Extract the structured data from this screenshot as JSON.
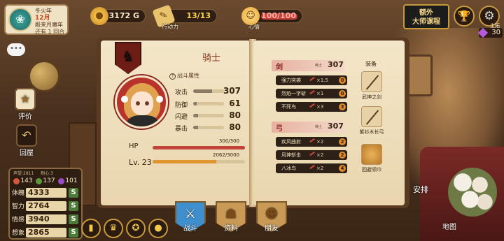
{
  "calendar": {
    "season": "冬火年",
    "month": "12月",
    "line3": "殿来月魔年",
    "line4": "还有 1 回合"
  },
  "resources": {
    "gold": "3172 G",
    "action_value": "13/13",
    "action_label": "行动力",
    "mood_value": "100/100",
    "mood_label": "心情"
  },
  "top_right": {
    "master_course": "额外\n大师课程",
    "gear_label": "主拓",
    "gem_count": "30"
  },
  "side": {
    "evaluate": "评价",
    "back": "回屋"
  },
  "stats_panel": {
    "header": [
      "声望:2811",
      "耐心:3"
    ],
    "mini": [
      {
        "label": "力量",
        "value": "143",
        "color": "#d25a3a"
      },
      {
        "label": "智慧",
        "value": "137",
        "color": "#5a9a3a"
      },
      {
        "label": "魅力",
        "value": "101",
        "color": "#9a4ac8"
      }
    ],
    "rows": [
      {
        "label": "体魄",
        "value": "4333",
        "grade": "S"
      },
      {
        "label": "智力",
        "value": "2764",
        "grade": "S"
      },
      {
        "label": "情感",
        "value": "3940",
        "grade": "S"
      },
      {
        "label": "想象",
        "value": "2865",
        "grade": "S"
      }
    ]
  },
  "character": {
    "class_name": "骑士",
    "combat_title": "战斗属性",
    "combat": [
      {
        "label": "攻击",
        "value": "307",
        "fraction": 0.62
      },
      {
        "label": "防御",
        "value": "61",
        "fraction": 0.12
      },
      {
        "label": "闪避",
        "value": "80",
        "fraction": 0.16
      },
      {
        "label": "暴击",
        "value": "80",
        "fraction": 0.16
      }
    ],
    "hp_label": "HP",
    "hp_value": "300/300",
    "hp_fraction": 1.0,
    "lv_label": "Lv. 23",
    "exp_value": "2062/3000",
    "exp_fraction": 0.69
  },
  "weapons": {
    "sword": {
      "name": "剑",
      "tag": "稀土",
      "value": "307",
      "skills": [
        {
          "name": "强力突袭",
          "mult": "×1.5",
          "lvl": "0"
        },
        {
          "name": "烈焰一字斩",
          "mult": "×1",
          "lvl": "0"
        },
        {
          "name": "不死鸟",
          "mult": "×3",
          "lvl": "3"
        }
      ]
    },
    "bow": {
      "name": "弓",
      "tag": "稀土",
      "value": "307",
      "skills": [
        {
          "name": "疾风曲射",
          "mult": "×2",
          "lvl": "2"
        },
        {
          "name": "风神斩击",
          "mult": "×2",
          "lvl": "2"
        },
        {
          "name": "八冰鸟",
          "mult": "×2",
          "lvl": "4"
        }
      ]
    }
  },
  "equipment": {
    "title": "装备",
    "items": [
      "武神之剑",
      "紫衫木长弓",
      "回避领巾"
    ]
  },
  "bottom_tabs": [
    "战斗",
    "资料",
    "朋友"
  ],
  "world": {
    "arrange": "安排",
    "map": "地图"
  }
}
